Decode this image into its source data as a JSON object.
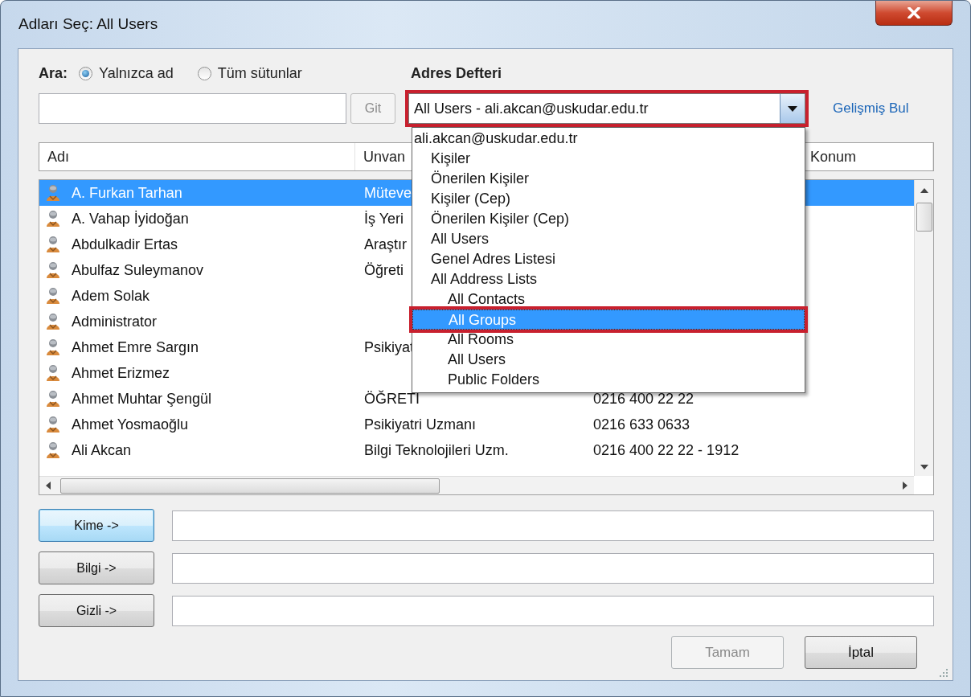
{
  "window": {
    "title": "Adları Seç: All Users"
  },
  "search": {
    "label": "Ara:",
    "options": [
      {
        "label": "Yalnızca ad",
        "selected": true
      },
      {
        "label": "Tüm sütunlar",
        "selected": false
      }
    ],
    "go_button": {
      "label": "Git",
      "disabled": true
    }
  },
  "address_book": {
    "label": "Adres Defteri",
    "value": "All Users - ali.akcan@uskudar.edu.tr",
    "annotated": true,
    "expanded": true,
    "options": [
      {
        "label": "ali.akcan@uskudar.edu.tr",
        "selected": false,
        "annotated": false,
        "children": [
          {
            "label": "Kişiler",
            "selected": false,
            "annotated": false
          },
          {
            "label": "Önerilen Kişiler",
            "selected": false,
            "annotated": false
          },
          {
            "label": "Kişiler (Cep)",
            "selected": false,
            "annotated": false
          },
          {
            "label": "Önerilen Kişiler (Cep)",
            "selected": false,
            "annotated": false
          },
          {
            "label": "All Users",
            "selected": false,
            "annotated": false
          },
          {
            "label": "Genel Adres Listesi",
            "selected": false,
            "annotated": false
          },
          {
            "label": "All Address Lists",
            "selected": false,
            "annotated": false,
            "children": [
              {
                "label": "All Contacts",
                "selected": false,
                "annotated": false
              },
              {
                "label": "All Groups",
                "selected": true,
                "annotated": true
              },
              {
                "label": "All Rooms",
                "selected": false,
                "annotated": false
              },
              {
                "label": "All Users",
                "selected": false,
                "annotated": false
              },
              {
                "label": "Public Folders",
                "selected": false,
                "annotated": false
              }
            ]
          }
        ]
      }
    ]
  },
  "advanced_find_link": "Gelişmiş Bul",
  "table": {
    "columns": [
      "Adı",
      "Unvan",
      "Konum"
    ],
    "rows": [
      {
        "name": "A. Furkan Tarhan",
        "title": "Müteve",
        "phone": "",
        "selected": true
      },
      {
        "name": "A. Vahap İyidoğan",
        "title": "İş Yeri",
        "phone": "",
        "selected": false
      },
      {
        "name": "Abdulkadir Ertas",
        "title": "Araştır",
        "phone": "",
        "selected": false
      },
      {
        "name": "Abulfaz Suleymanov",
        "title": "Öğreti",
        "phone": "",
        "selected": false
      },
      {
        "name": "Adem Solak",
        "title": "",
        "phone": "",
        "selected": false
      },
      {
        "name": "Administrator",
        "title": "",
        "phone": "",
        "selected": false
      },
      {
        "name": "Ahmet Emre Sargın",
        "title": "Psikiyat",
        "phone": "",
        "selected": false
      },
      {
        "name": "Ahmet Erizmez",
        "title": "",
        "phone": "",
        "selected": false
      },
      {
        "name": "Ahmet Muhtar Şengül",
        "title": "ÖĞRETİ",
        "phone": "0216 400 22 22",
        "selected": false
      },
      {
        "name": "Ahmet Yosmaoğlu",
        "title": "Psikiyatri Uzmanı",
        "phone": "0216 633 0633",
        "selected": false
      },
      {
        "name": "Ali Akcan",
        "title": "Bilgi Teknolojileri Uzm.",
        "phone": "0216 400 22 22 - 1912",
        "selected": false
      }
    ]
  },
  "recipients": [
    {
      "button": "Kime ->",
      "focused": true
    },
    {
      "button": "Bilgi ->",
      "focused": false
    },
    {
      "button": "Gizli ->",
      "focused": false
    }
  ],
  "buttons": [
    {
      "label": "Tamam",
      "disabled": true
    },
    {
      "label": "İptal",
      "disabled": false
    }
  ]
}
